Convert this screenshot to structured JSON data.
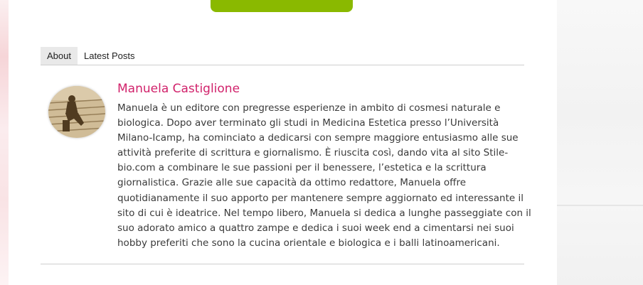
{
  "tabs": [
    {
      "label": "About",
      "active": true
    },
    {
      "label": "Latest Posts",
      "active": false
    }
  ],
  "author": {
    "name": "Manuela Castiglione",
    "bio_lines": [
      "Manuela è un editore con pregresse esperienze in ambito di cosmesi naturale e",
      "biologica. Dopo aver terminato gli studi in Medicina Estetica presso l’Università",
      "Milano-Icamp, ha cominciato a dedicarsi con sempre maggiore entusiasmo alle sue",
      "attività preferite di scrittura e giornalismo. È riuscita così, dando vita al sito Stile-",
      "bio.com a combinare le sue passioni per il benessere, l’estetica e la scrittura",
      "giornalistica. Grazie alle sue capacità da ottimo redattore, Manuela offre",
      "quotidianamente il suo apporto per mantenere sempre aggiornato ed interessante il",
      "sito di cui è ideatrice. Nel tempo libero, Manuela si dedica a lunghe passeggiate con il",
      "suo adorato amico a quattro zampe e dedica i suoi week end a cimentarsi nei suoi",
      "hobby preferiti che sono la cucina orientale e biologica e i balli latinoamericani."
    ]
  },
  "colors": {
    "accent_green": "#8ab900",
    "author_name": "#d1226b",
    "text": "#3a3a3a"
  }
}
